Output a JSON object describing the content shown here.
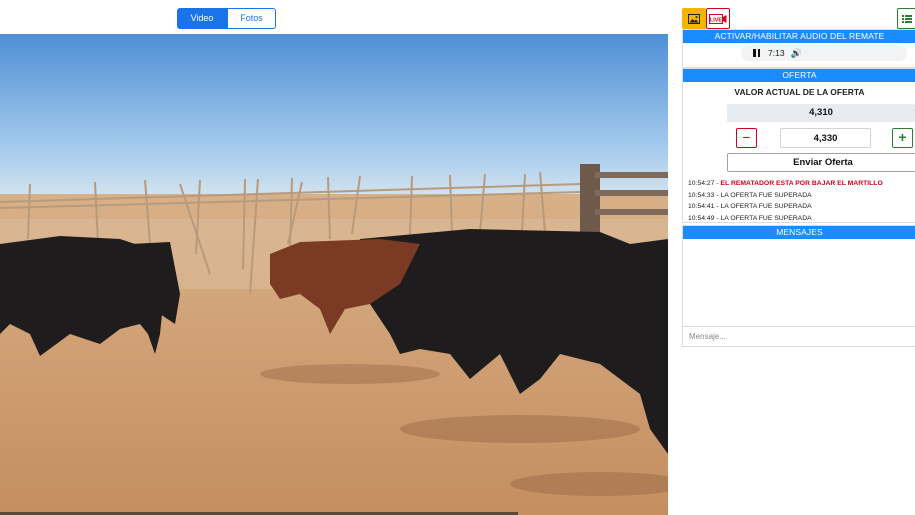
{
  "tabs": {
    "video": "Video",
    "photos": "Fotos"
  },
  "toolbar": {
    "image_icon": "image-icon",
    "live_label": "LIVE",
    "list_icon": "list-icon"
  },
  "audio": {
    "header": "ACTIVAR/HABILITAR AUDIO DEL REMATE",
    "time": "7:13",
    "volume_icon": "🔊"
  },
  "oferta": {
    "header": "OFERTA",
    "current_label": "VALOR ACTUAL DE LA OFERTA",
    "current_value": "4,310",
    "minus_label": "−",
    "plus_label": "+",
    "bid_value": "4,330",
    "send_label": "Enviar Oferta",
    "log": [
      {
        "time": "10:54:27 - ",
        "text": "EL REMATADOR ESTA POR BAJAR EL MARTILLO"
      },
      {
        "time": "10:54:33 - ",
        "text": "LA OFERTA FUE SUPERADA"
      },
      {
        "time": "10:54:41 - ",
        "text": "LA OFERTA FUE SUPERADA"
      },
      {
        "time": "10:54:49 - ",
        "text": "LA OFERTA FUE SUPERADA"
      }
    ]
  },
  "mensajes": {
    "header": "MENSAJES",
    "placeholder": "Mensaje..."
  },
  "colors": {
    "accent": "#1a8cff",
    "alert": "#d0021b",
    "plus": "#2e7d32",
    "image_btn": "#f4b400"
  }
}
